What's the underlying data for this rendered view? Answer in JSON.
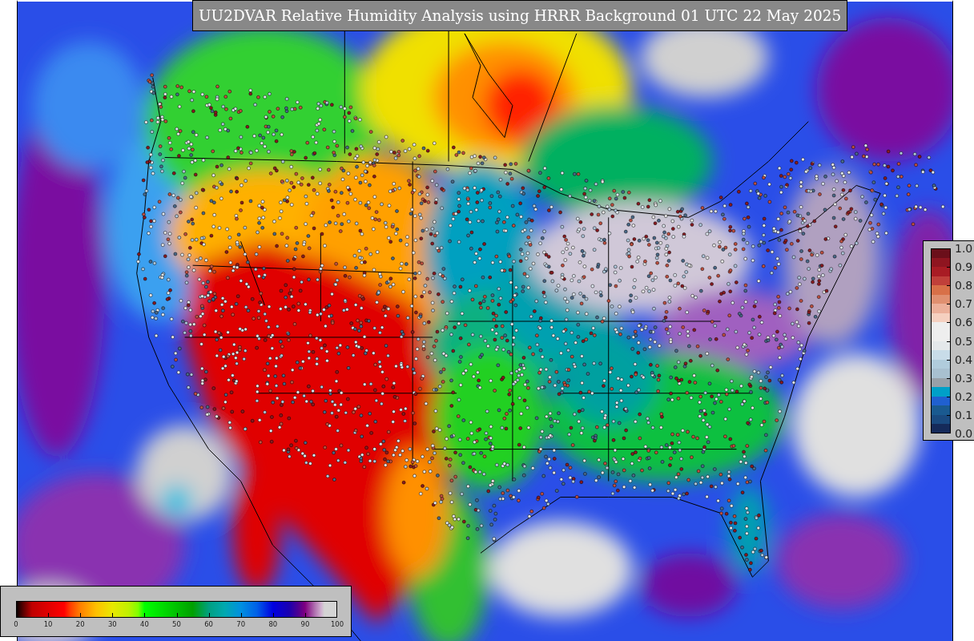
{
  "title": "UU2DVAR Relative Humidity Analysis using HRRR Background 01 UTC 22 May 2025",
  "side_colorbar": {
    "ticks": [
      "1.0",
      "0.9",
      "0.8",
      "0.7",
      "0.6",
      "0.5",
      "0.4",
      "0.3",
      "0.2",
      "0.1",
      "0.0"
    ]
  },
  "bottom_colorbar": {
    "ticks": [
      "0",
      "10",
      "20",
      "30",
      "40",
      "50",
      "60",
      "70",
      "80",
      "90",
      "100"
    ]
  }
}
